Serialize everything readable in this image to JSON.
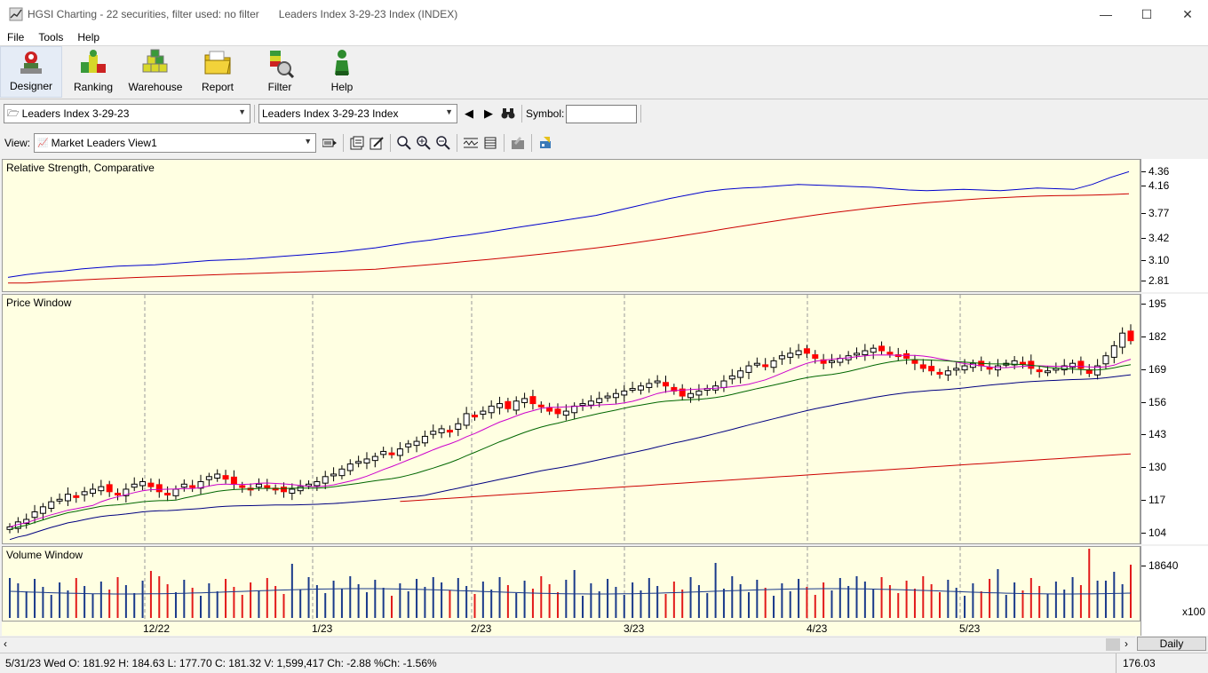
{
  "window": {
    "title_main": "HGSI Charting - 22 securities, filter used: no filter",
    "title_sub": "Leaders Index 3-29-23 Index (INDEX)",
    "minimize": "—",
    "maximize": "☐",
    "close": "✕"
  },
  "menu": [
    "File",
    "Tools",
    "Help"
  ],
  "toolbar": {
    "designer": "Designer",
    "ranking": "Ranking",
    "warehouse": "Warehouse",
    "report": "Report",
    "filter": "Filter",
    "help": "Help"
  },
  "selector": {
    "list": "Leaders Index 3-29-23",
    "security": "Leaders Index 3-29-23 Index",
    "symbol_label": "Symbol:",
    "symbol_value": ""
  },
  "view": {
    "label": "View:",
    "value": "Market Leaders View1"
  },
  "panes": {
    "rs": {
      "title": "Relative Strength, Comparative",
      "ticks": [
        "4.36",
        "4.16",
        "3.77",
        "3.42",
        "3.10",
        "2.81"
      ],
      "tick_values": [
        4.36,
        4.16,
        3.77,
        3.42,
        3.1,
        2.81
      ]
    },
    "price": {
      "title": "Price Window",
      "ticks": [
        "195",
        "182",
        "169",
        "156",
        "143",
        "130",
        "117",
        "104"
      ],
      "tick_values": [
        195,
        182,
        169,
        156,
        143,
        130,
        117,
        104
      ]
    },
    "volume": {
      "title": "Volume Window",
      "tick": "18640",
      "multiplier": "x100"
    }
  },
  "dates": [
    "12/22",
    "1/23",
    "2/23",
    "3/23",
    "4/23",
    "5/23"
  ],
  "timeframe": "Daily",
  "status": {
    "bar_info": "5/31/23 Wed O: 181.92 H: 184.63 L: 177.70 C: 181.32 V: 1,599,417 Ch: -2.88 %Ch: -1.56%",
    "cursor_value": "176.03"
  },
  "colors": {
    "pane_bg": "#ffffe2",
    "up_candle": "#ffffff",
    "down_candle": "#ff0000",
    "rs_line": "#0000cc",
    "rs_ma": "#cc0000",
    "ma_fast": "#cc00cc",
    "ma_mid": "#006600",
    "ma_slow": "#000080",
    "ma_long": "#cc0000"
  },
  "chart_data": {
    "type": "line",
    "last_bar": {
      "date": "5/31/23",
      "open": 181.92,
      "high": 184.63,
      "low": 177.7,
      "close": 181.32,
      "volume": 1599417
    },
    "price_close_approx": [
      107,
      109,
      110,
      113,
      115,
      117,
      118,
      120,
      119,
      121,
      122,
      123,
      121,
      120,
      122,
      124,
      125,
      123,
      121,
      120,
      122,
      124,
      123,
      125,
      127,
      128,
      126,
      124,
      123,
      122,
      124,
      123,
      122,
      121,
      122,
      123,
      124,
      125,
      127,
      128,
      130,
      132,
      133,
      134,
      135,
      137,
      136,
      138,
      140,
      141,
      143,
      145,
      146,
      145,
      148,
      152,
      151,
      153,
      155,
      156,
      154,
      157,
      158,
      156,
      155,
      153,
      152,
      153,
      155,
      156,
      157,
      158,
      159,
      160,
      161,
      162,
      163,
      164,
      165,
      163,
      161,
      159,
      160,
      161,
      162,
      163,
      165,
      167,
      169,
      171,
      172,
      171,
      173,
      175,
      176,
      177,
      176,
      174,
      172,
      173,
      174,
      175,
      176,
      177,
      178,
      177,
      176,
      175,
      174,
      172,
      170,
      169,
      168,
      169,
      170,
      171,
      172,
      171,
      170,
      171,
      172,
      173,
      172,
      170,
      169,
      169,
      170,
      171,
      172,
      170,
      168,
      171,
      175,
      179,
      184,
      181
    ],
    "rs_approx": [
      2.88,
      2.92,
      2.95,
      2.97,
      3.0,
      3.02,
      3.04,
      3.05,
      3.06,
      3.08,
      3.1,
      3.12,
      3.13,
      3.14,
      3.16,
      3.18,
      3.2,
      3.22,
      3.24,
      3.27,
      3.3,
      3.34,
      3.38,
      3.41,
      3.45,
      3.48,
      3.52,
      3.56,
      3.6,
      3.64,
      3.68,
      3.72,
      3.76,
      3.82,
      3.88,
      3.94,
      4.0,
      4.05,
      4.1,
      4.13,
      4.15,
      4.16,
      4.18,
      4.2,
      4.19,
      4.18,
      4.17,
      4.16,
      4.14,
      4.12,
      4.11,
      4.12,
      4.13,
      4.12,
      4.11,
      4.13,
      4.15,
      4.14,
      4.13,
      4.2,
      4.3,
      4.38
    ]
  }
}
